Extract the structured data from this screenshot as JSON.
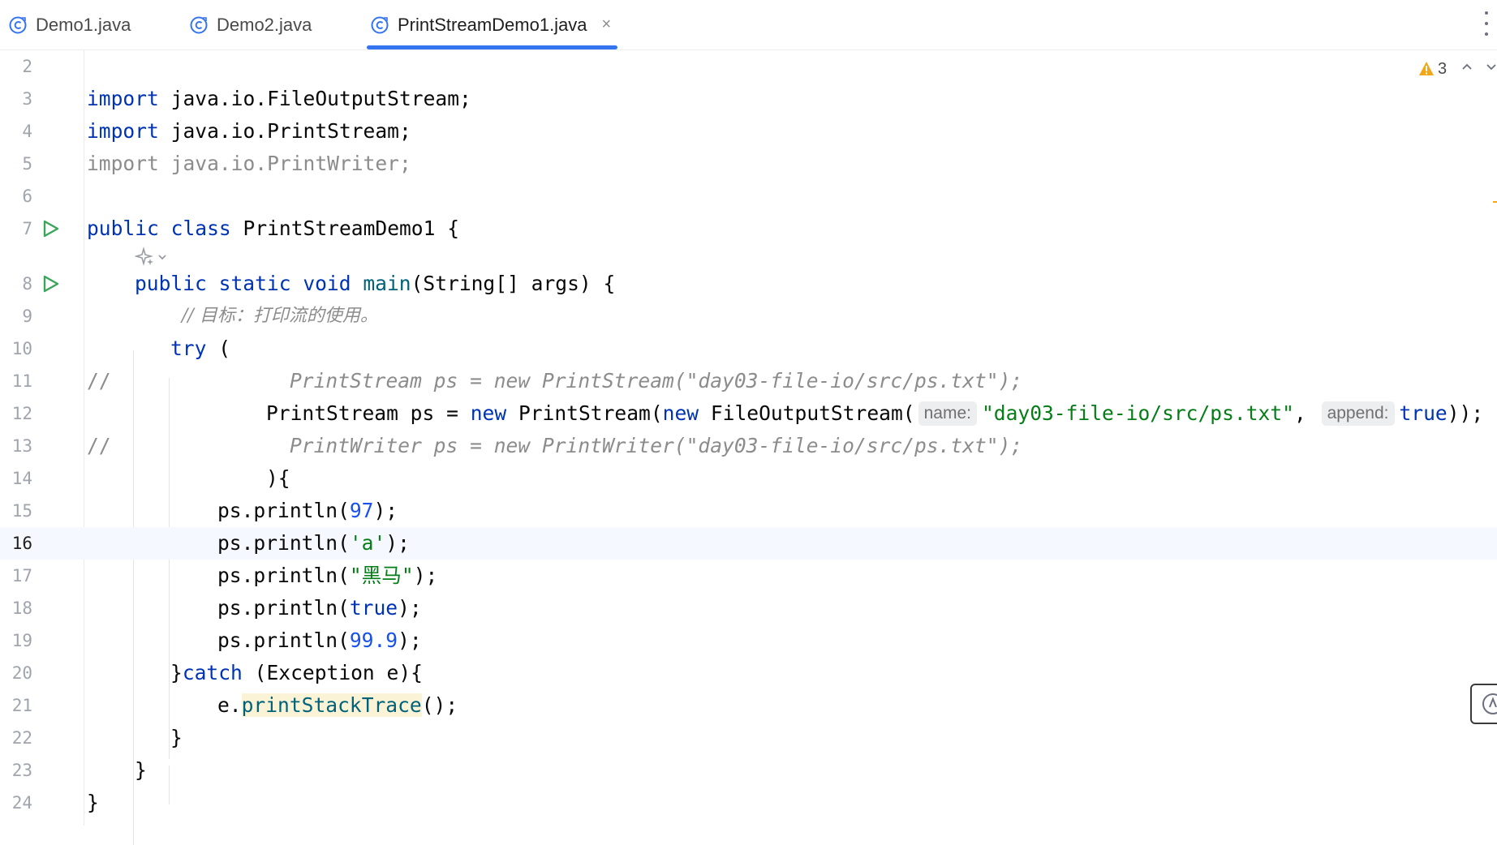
{
  "tabs": [
    {
      "label": "Demo1.java",
      "active": false
    },
    {
      "label": "Demo2.java",
      "active": false
    },
    {
      "label": "PrintStreamDemo1.java",
      "active": true
    }
  ],
  "tab_close_glyph": "×",
  "inspections": {
    "warning_count": "3"
  },
  "editor": {
    "current_line": "16",
    "line_numbers": [
      "2",
      "3",
      "4",
      "5",
      "6",
      "7",
      "8",
      "9",
      "10",
      "11",
      "12",
      "13",
      "14",
      "15",
      "16",
      "17",
      "18",
      "19",
      "20",
      "21",
      "22",
      "23",
      "24"
    ],
    "code": {
      "l3_kw": "import",
      "l3_rest": " java.io.FileOutputStream;",
      "l4_kw": "import",
      "l4_rest": " java.io.PrintStream;",
      "l5_text": "import java.io.PrintWriter;",
      "l7_kw1": "public",
      "l7_kw2": "class",
      "l7_rest": " PrintStreamDemo1 {",
      "l8_kw1": "public",
      "l8_kw2": "static",
      "l8_kw3": "void",
      "l8_fn": "main",
      "l8_rest": "(String[] args) {",
      "l9_comment": "// 目标：打印流的使用。",
      "l10_kw": "try",
      "l10_rest": " (",
      "l11_slashes": "//",
      "l11_comment": "PrintStream ps = new PrintStream(\"day03-file-io/src/ps.txt\");",
      "l12_a": "PrintStream ps = ",
      "l12_kw1": "new",
      "l12_b": " PrintStream(",
      "l12_kw2": "new",
      "l12_c": " FileOutputStream(",
      "l12_hint1": "name:",
      "l12_str": "\"day03-file-io/src/ps.txt\"",
      "l12_d": ", ",
      "l12_hint2": "append:",
      "l12_kw3": "true",
      "l12_e": "));",
      "l13_slashes": "//",
      "l13_comment": "PrintWriter ps = new PrintWriter(\"day03-file-io/src/ps.txt\");",
      "l14_text": "){",
      "l15_a": "ps.println(",
      "l15_num": "97",
      "l15_b": ");",
      "l16_a": "ps.println(",
      "l16_str": "'a'",
      "l16_b": ");",
      "l17_a": "ps.println(",
      "l17_str": "\"黑马\"",
      "l17_b": ");",
      "l18_a": "ps.println(",
      "l18_kw": "true",
      "l18_b": ");",
      "l19_a": "ps.println(",
      "l19_num": "99.9",
      "l19_b": ");",
      "l20_a": "}",
      "l20_kw": "catch",
      "l20_b": " (Exception e){",
      "l21_a": "e.",
      "l21_fn": "printStackTrace",
      "l21_b": "();",
      "l22_text": "}",
      "l23_text": "}",
      "l24_text": "}"
    }
  },
  "colors": {
    "keyword": "#0033b3",
    "string": "#067d17",
    "number": "#1750eb",
    "method": "#00627a",
    "comment": "#8c8c8c",
    "tab_active_underline": "#3574f0",
    "run_icon": "#3aa65b",
    "warning": "#f2a71b"
  },
  "icons": {
    "tab_file": "java-class-icon",
    "gutter_run": "run-play-icon",
    "warning": "warning-triangle-icon",
    "ai": "ai-sparkle-icon",
    "more": "kebab-menu-icon"
  }
}
